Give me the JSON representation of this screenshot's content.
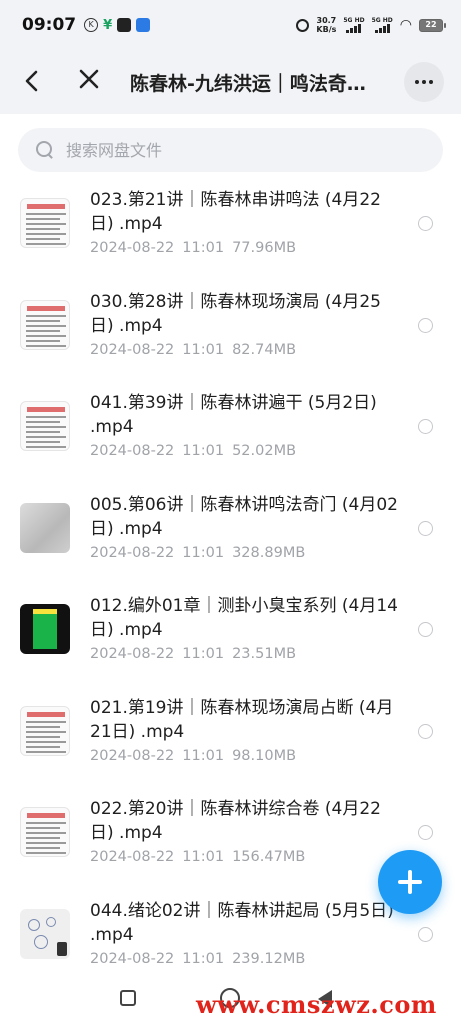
{
  "status_bar": {
    "time": "09:07",
    "net_speed_value": "30.7",
    "net_speed_unit": "KB/s",
    "signal1_label": "5G HD",
    "signal2_label": "5G HD",
    "battery": "22"
  },
  "nav": {
    "title": "陈春林-九纬洪运｜鸣法奇…",
    "back_icon": "back-arrow-icon",
    "close_icon": "close-icon",
    "more_icon": "more-icon"
  },
  "search": {
    "placeholder": "搜索网盘文件"
  },
  "files": [
    {
      "name": "023.第21讲｜陈春林串讲鸣法 (4月22日) .mp4",
      "date": "2024-08-22",
      "time": "11:01",
      "size": "77.96MB",
      "thumb": "doc"
    },
    {
      "name": "030.第28讲｜陈春林现场演局 (4月25日) .mp4",
      "date": "2024-08-22",
      "time": "11:01",
      "size": "82.74MB",
      "thumb": "doc"
    },
    {
      "name": "041.第39讲｜陈春林讲遍干 (5月2日) .mp4",
      "date": "2024-08-22",
      "time": "11:01",
      "size": "52.02MB",
      "thumb": "doc"
    },
    {
      "name": "005.第06讲｜陈春林讲鸣法奇门 (4月02日) .mp4",
      "date": "2024-08-22",
      "time": "11:01",
      "size": "328.89MB",
      "thumb": "photo"
    },
    {
      "name": "012.编外01章｜测卦小臭宝系列 (4月14日) .mp4",
      "date": "2024-08-22",
      "time": "11:01",
      "size": "23.51MB",
      "thumb": "phone"
    },
    {
      "name": "021.第19讲｜陈春林现场演局占断 (4月21日) .mp4",
      "date": "2024-08-22",
      "time": "11:01",
      "size": "98.10MB",
      "thumb": "doc"
    },
    {
      "name": "022.第20讲｜陈春林讲综合卷 (4月22日) .mp4",
      "date": "2024-08-22",
      "time": "11:01",
      "size": "156.47MB",
      "thumb": "doc"
    },
    {
      "name": "044.绪论02讲｜陈春林讲起局 (5月5日) .mp4",
      "date": "2024-08-22",
      "time": "11:01",
      "size": "239.12MB",
      "thumb": "sketch"
    }
  ],
  "fab": {
    "icon": "plus-icon"
  },
  "accent_color": "#1e9bf5",
  "watermark": "www.cmszwz.com"
}
